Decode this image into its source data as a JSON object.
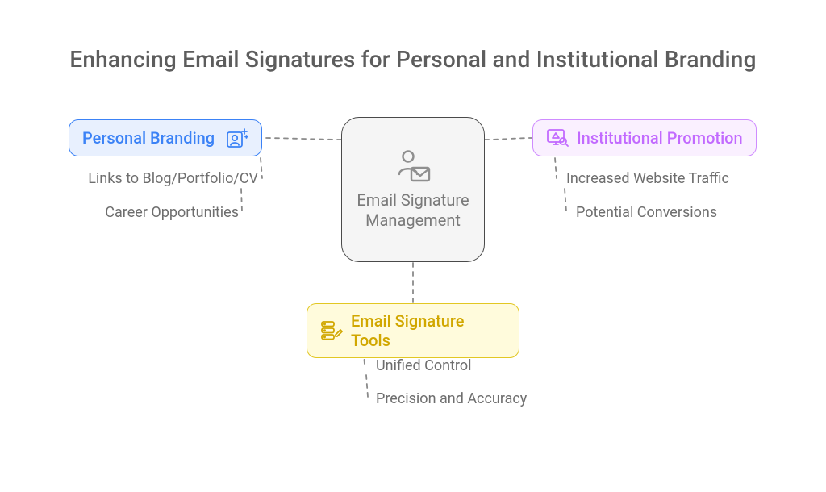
{
  "title": "Enhancing Email Signatures for Personal and Institutional Branding",
  "center": {
    "label": "Email Signature Management",
    "icon_name": "person-mail-icon"
  },
  "branches": {
    "personal_branding": {
      "label": "Personal Branding",
      "icon_name": "person-card-sparkle-icon",
      "color": "#3b82f6",
      "children": [
        "Links to Blog/Portfolio/CV",
        "Career Opportunities"
      ]
    },
    "institutional_promotion": {
      "label": "Institutional Promotion",
      "icon_name": "display-search-icon",
      "color": "#c26aff",
      "children": [
        "Increased Website Traffic",
        "Potential Conversions"
      ]
    },
    "email_signature_tools": {
      "label": "Email Signature Tools",
      "icon_name": "server-edit-icon",
      "color": "#d1a700",
      "children": [
        "Unified Control",
        "Precision and Accuracy"
      ]
    }
  }
}
